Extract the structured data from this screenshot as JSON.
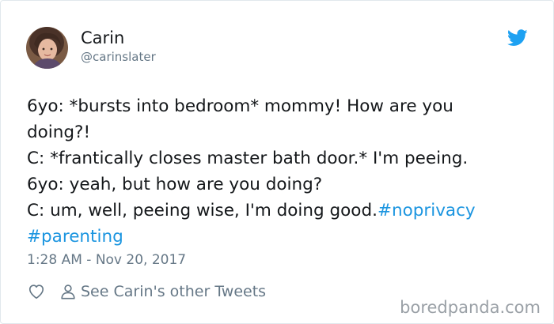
{
  "user": {
    "name": "Carin",
    "handle": "@carinslater"
  },
  "tweet": {
    "lines": [
      "6yo: *bursts into bedroom* mommy! How are you",
      "doing?!",
      "C: *frantically closes master bath door.* I'm peeing.",
      "6yo: yeah, but how are you doing?",
      "C: um, well, peeing wise, I'm doing good."
    ],
    "hashtag_1": "#noprivacy",
    "hashtag_2": "#parenting",
    "timestamp": "1:28 AM - Nov 20, 2017"
  },
  "actions": {
    "other_tweets_label": "See Carin's other Tweets"
  },
  "watermark": "boredpanda.com",
  "icons": {
    "avatar": "avatar-photo",
    "brand": "twitter-bird-icon",
    "like": "heart-icon",
    "profile": "person-icon"
  },
  "colors": {
    "text": "#14171a",
    "secondary": "#657786",
    "link": "#1b95e0",
    "twitter_blue": "#1da1f2"
  }
}
